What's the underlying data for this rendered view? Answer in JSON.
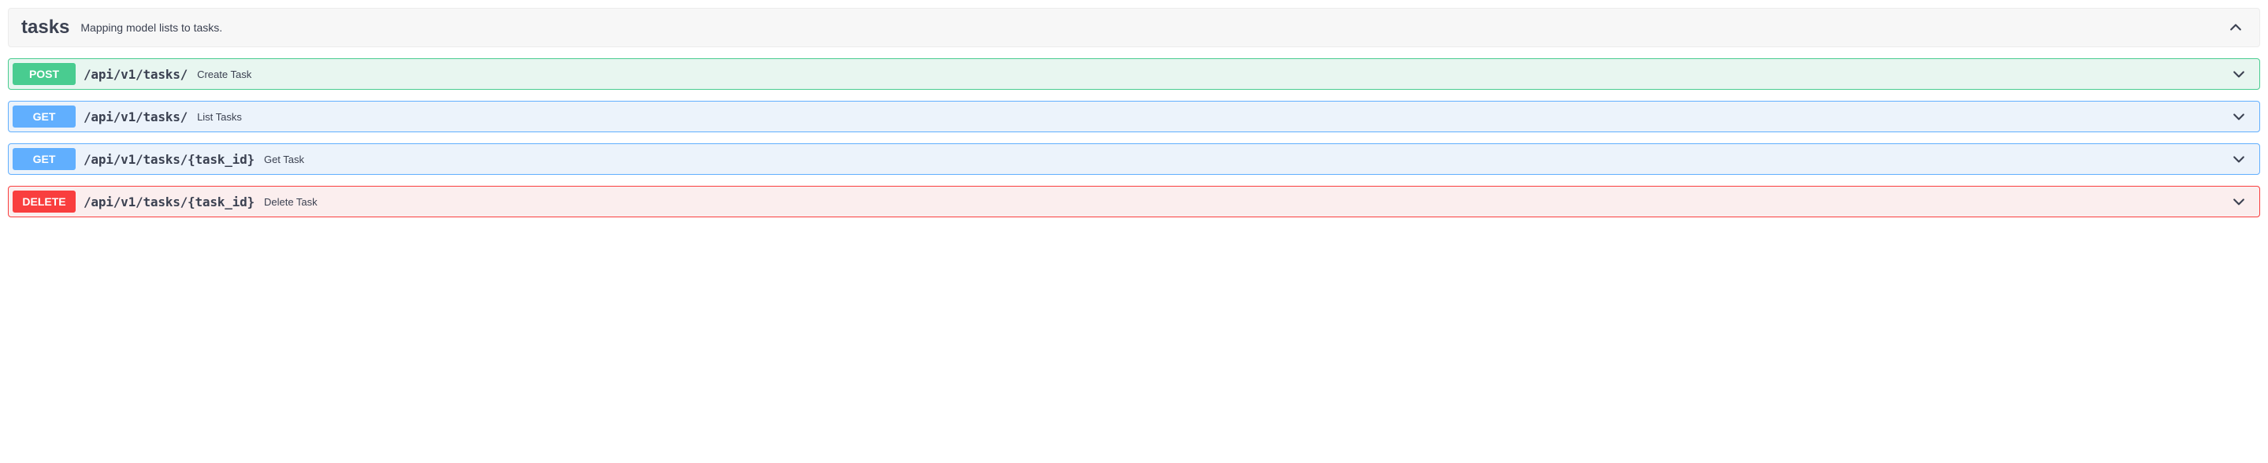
{
  "tag": {
    "name": "tasks",
    "description": "Mapping model lists to tasks."
  },
  "operations": [
    {
      "method": "POST",
      "method_class": "post",
      "path": "/api/v1/tasks/",
      "summary": "Create Task"
    },
    {
      "method": "GET",
      "method_class": "get",
      "path": "/api/v1/tasks/",
      "summary": "List Tasks"
    },
    {
      "method": "GET",
      "method_class": "get",
      "path": "/api/v1/tasks/{task_id}",
      "summary": "Get Task"
    },
    {
      "method": "DELETE",
      "method_class": "delete",
      "path": "/api/v1/tasks/{task_id}",
      "summary": "Delete Task"
    }
  ]
}
